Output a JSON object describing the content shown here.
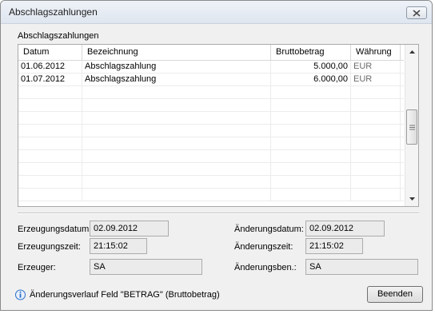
{
  "window": {
    "title": "Abschlagszahlungen"
  },
  "group": {
    "label": "Abschlagszahlungen"
  },
  "table": {
    "columns": [
      "Datum",
      "Bezeichnung",
      "Bruttobetrag",
      "Währung"
    ],
    "rows": [
      {
        "datum": "01.06.2012",
        "bezeichnung": "Abschlagszahlung",
        "betrag": "5.000,00",
        "waehrung": "EUR"
      },
      {
        "datum": "01.07.2012",
        "bezeichnung": "Abschlagszahlung",
        "betrag": "6.000,00",
        "waehrung": "EUR"
      }
    ]
  },
  "fields": {
    "erzeugungsdatum": {
      "label": "Erzeugungsdatum:",
      "value": "02.09.2012"
    },
    "erzeugungszeit": {
      "label": "Erzeugungszeit:",
      "value": "21:15:02"
    },
    "erzeuger": {
      "label": "Erzeuger:",
      "value": "SA"
    },
    "aenderungsdatum": {
      "label": "Änderungsdatum:",
      "value": "02.09.2012"
    },
    "aenderungszeit": {
      "label": "Änderungszeit:",
      "value": "21:15:02"
    },
    "aenderungsben": {
      "label": "Änderungsben.:",
      "value": "SA"
    }
  },
  "footer": {
    "info_text": "Änderungsverlauf Feld \"BETRAG\" (Bruttobetrag)",
    "close_label": "Beenden"
  },
  "icons": {
    "close": "close-icon",
    "info": "info-icon",
    "scroll_up": "arrow-up-icon",
    "scroll_down": "arrow-down-icon"
  },
  "colors": {
    "titlebar": "#dfe6ef",
    "window_bg": "#f0f0f0",
    "field_bg": "#ebebeb",
    "info_blue": "#2a6fc9"
  }
}
